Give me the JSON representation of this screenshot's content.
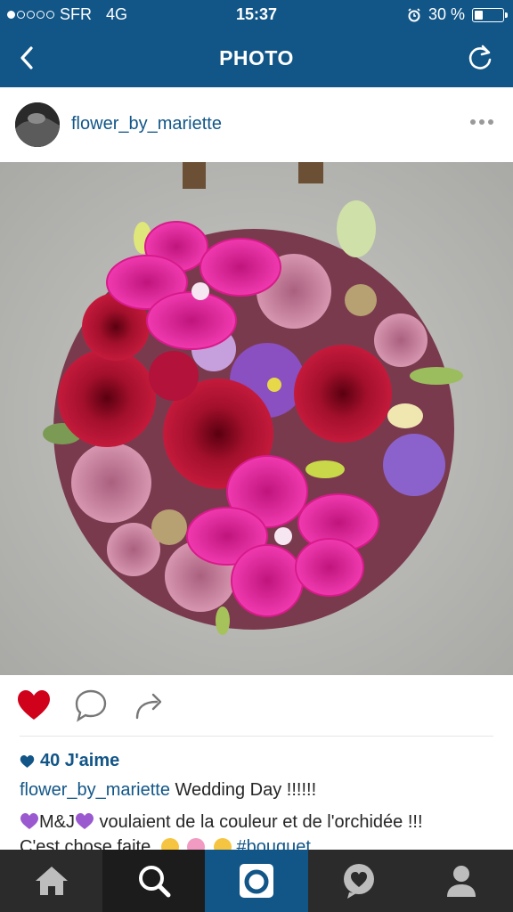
{
  "status": {
    "carrier": "SFR",
    "network": "4G",
    "time": "15:37",
    "battery": "30 %",
    "battery_level": 0.3
  },
  "nav": {
    "title": "PHOTO"
  },
  "post": {
    "username": "flower_by_mariette",
    "likes": "40 J'aime",
    "caption_user": "flower_by_mariette",
    "caption_text": " Wedding Day !!!!!!",
    "line2_text": "M&J",
    "line2_rest": " voulaient de la couleur et de l'orchidée !!!",
    "line3_text": "C'est chose faite",
    "line3_tag": "#bouquet"
  },
  "colors": {
    "brand": "#125688",
    "like": "#d0021b",
    "emoji_heart": "#9b59d0"
  },
  "icons": {
    "back": "chevron-left-icon",
    "refresh": "refresh-icon",
    "like": "heart-icon",
    "comment": "comment-icon",
    "share": "share-icon",
    "home": "home-icon",
    "search": "search-icon",
    "camera": "camera-icon",
    "activity": "activity-icon",
    "profile": "profile-icon"
  }
}
